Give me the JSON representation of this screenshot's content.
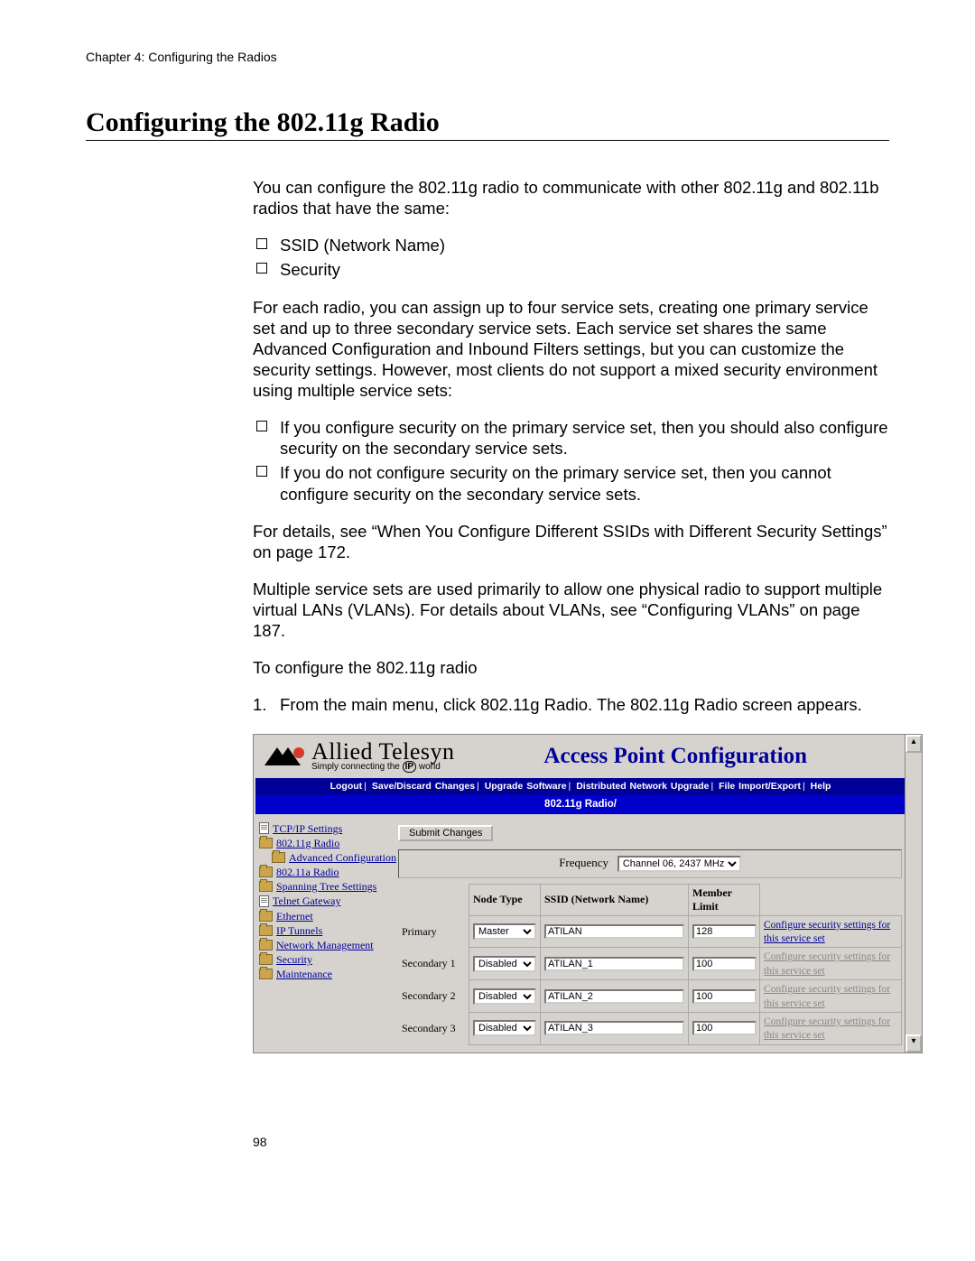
{
  "doc": {
    "chapter_header": "Chapter 4: Configuring the Radios",
    "section_title": "Configuring the 802.11g Radio",
    "p1": "You can configure the 802.11g radio to communicate with other 802.11g and 802.11b radios that have the same:",
    "bullets1": {
      "b1": "SSID (Network Name)",
      "b2": "Security"
    },
    "p2": "For each radio, you can assign up to four service sets, creating one primary service set and up to three secondary service sets. Each service set shares the same Advanced Configuration and Inbound Filters settings, but you can customize the security settings. However, most clients do not support a mixed security environment using multiple service sets:",
    "bullets2": {
      "b1": "If you configure security on the primary service set, then you should also configure security on the secondary service sets.",
      "b2": "If you do not configure security on the primary service set, then you cannot configure security on the secondary service sets."
    },
    "p3": "For details, see “When You Configure Different SSIDs with Different Security Settings” on page 172.",
    "p4": "Multiple service sets are used primarily to allow one physical radio to support multiple virtual LANs (VLANs). For details about VLANs, see “Configuring VLANs” on page 187.",
    "p5": "To configure the 802.11g radio",
    "step1_num": "1.",
    "step1": "From the main menu, click 802.11g Radio. The 802.11g Radio screen appears.",
    "page_number": "98"
  },
  "ui": {
    "brand_name": "Allied Telesyn",
    "brand_tag_prefix": "Simply connecting the",
    "brand_tag_ip": "IP",
    "brand_tag_suffix": "world",
    "page_title": "Access Point Configuration",
    "menubar": {
      "m1": "Logout",
      "m2": "Save/Discard Changes",
      "m3": "Upgrade Software",
      "m4": "Distributed Network Upgrade",
      "m5": "File Import/Export",
      "m6": "Help"
    },
    "breadcrumb": "802.11g Radio/",
    "nav": {
      "n1": "TCP/IP Settings",
      "n2": "802.11g Radio",
      "n2a": "Advanced Configuration",
      "n3": "802.11a Radio",
      "n4": "Spanning Tree Settings",
      "n5": "Telnet Gateway",
      "n6": "Ethernet",
      "n7": "IP Tunnels",
      "n8": "Network Management",
      "n9": "Security",
      "n10": "Maintenance"
    },
    "submit_label": "Submit Changes",
    "frequency_label": "Frequency",
    "frequency_value": "Channel 06, 2437 MHz",
    "table": {
      "h_node": "Node Type",
      "h_ssid": "SSID (Network Name)",
      "h_limit": "Member Limit",
      "rows": [
        {
          "label": "Primary",
          "node": "Master",
          "ssid": "ATILAN",
          "limit": "128",
          "cfg": "Configure security settings for this service set",
          "enabled": true
        },
        {
          "label": "Secondary 1",
          "node": "Disabled",
          "ssid": "ATILAN_1",
          "limit": "100",
          "cfg": "Configure security settings for this service set",
          "enabled": false
        },
        {
          "label": "Secondary 2",
          "node": "Disabled",
          "ssid": "ATILAN_2",
          "limit": "100",
          "cfg": "Configure security settings for this service set",
          "enabled": false
        },
        {
          "label": "Secondary 3",
          "node": "Disabled",
          "ssid": "ATILAN_3",
          "limit": "100",
          "cfg": "Configure security settings for this service set",
          "enabled": false
        }
      ]
    },
    "scroll_up": "▴",
    "scroll_down": "▾"
  }
}
